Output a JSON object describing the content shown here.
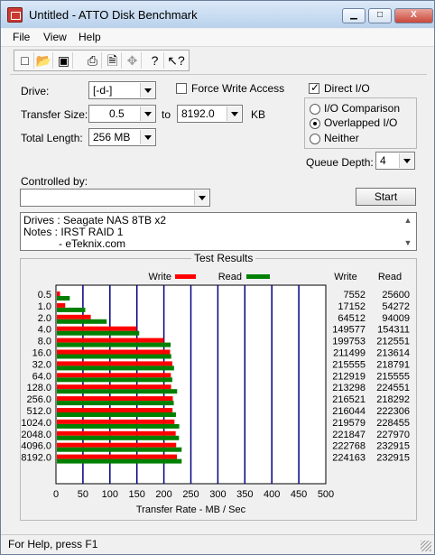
{
  "window": {
    "title": "Untitled - ATTO Disk Benchmark",
    "minimize": "▁",
    "maximize": "□",
    "close": "X"
  },
  "menu": {
    "file": "File",
    "view": "View",
    "help": "Help"
  },
  "toolbar": {
    "icons": [
      "new-document-icon",
      "open-folder-icon",
      "save-disk-icon",
      "print-icon",
      "print-preview-icon",
      "move-icon",
      "help-icon",
      "context-help-icon"
    ],
    "glyphs": {
      "new": "□",
      "open": "📂",
      "save": "▣",
      "print": "⎙",
      "preview": "🗎",
      "move": "✥",
      "help": "?",
      "context_help": "↖?"
    }
  },
  "settings": {
    "drive_label": "Drive:",
    "drive_value": "[-d-]",
    "force_write_label": "Force Write Access",
    "direct_io_label": "Direct I/O",
    "transfer_size_label": "Transfer Size:",
    "transfer_from": "0.5",
    "to_label": "to",
    "transfer_to": "8192.0",
    "kb_label": "KB",
    "total_length_label": "Total Length:",
    "total_length_value": "256 MB",
    "io_comparison_label": "I/O Comparison",
    "overlapped_io_label": "Overlapped I/O",
    "neither_label": "Neither",
    "queue_depth_label": "Queue Depth:",
    "queue_depth_value": "4",
    "controlled_by_label": "Controlled by:",
    "controlled_by_value": "",
    "start_label": "Start"
  },
  "notes": {
    "line1": "Drives : Seagate NAS 8TB x2",
    "line2": "Notes : IRST RAID 1",
    "line3": "- eTeknix.com"
  },
  "chart_data": {
    "type": "bar",
    "title": "Test Results",
    "xlabel": "Transfer Rate - MB / Sec",
    "ylabel": "",
    "xlim": [
      0,
      500
    ],
    "x_ticks": [
      0,
      50,
      100,
      150,
      200,
      250,
      300,
      350,
      400,
      450,
      500
    ],
    "legend": [
      {
        "name": "Write",
        "color": "#ff0000"
      },
      {
        "name": "Read",
        "color": "#008000"
      }
    ],
    "categories": [
      "0.5",
      "1.0",
      "2.0",
      "4.0",
      "8.0",
      "16.0",
      "32.0",
      "64.0",
      "128.0",
      "256.0",
      "512.0",
      "1024.0",
      "2048.0",
      "4096.0",
      "8192.0"
    ],
    "series": [
      {
        "name": "Write",
        "color": "#ff0000",
        "values": [
          7.552,
          17.152,
          64.512,
          149.577,
          199.753,
          211.499,
          215.555,
          212.919,
          213.298,
          216.521,
          216.044,
          219.579,
          221.847,
          222.768,
          224.163
        ]
      },
      {
        "name": "Read",
        "color": "#008000",
        "values": [
          25.6,
          54.272,
          94.009,
          154.311,
          212.551,
          213.614,
          218.791,
          215.555,
          224.551,
          218.292,
          222.306,
          228.455,
          227.97,
          232.915,
          232.915
        ]
      }
    ],
    "table_headers": {
      "write": "Write",
      "read": "Read"
    },
    "write_numbers": [
      "7552",
      "17152",
      "64512",
      "149577",
      "199753",
      "211499",
      "215555",
      "212919",
      "213298",
      "216521",
      "216044",
      "219579",
      "221847",
      "222768",
      "224163"
    ],
    "read_numbers": [
      "25600",
      "54272",
      "94009",
      "154311",
      "212551",
      "213614",
      "218791",
      "215555",
      "224551",
      "218292",
      "222306",
      "228455",
      "227970",
      "232915",
      "232915"
    ]
  },
  "status": {
    "text": "For Help, press F1"
  }
}
